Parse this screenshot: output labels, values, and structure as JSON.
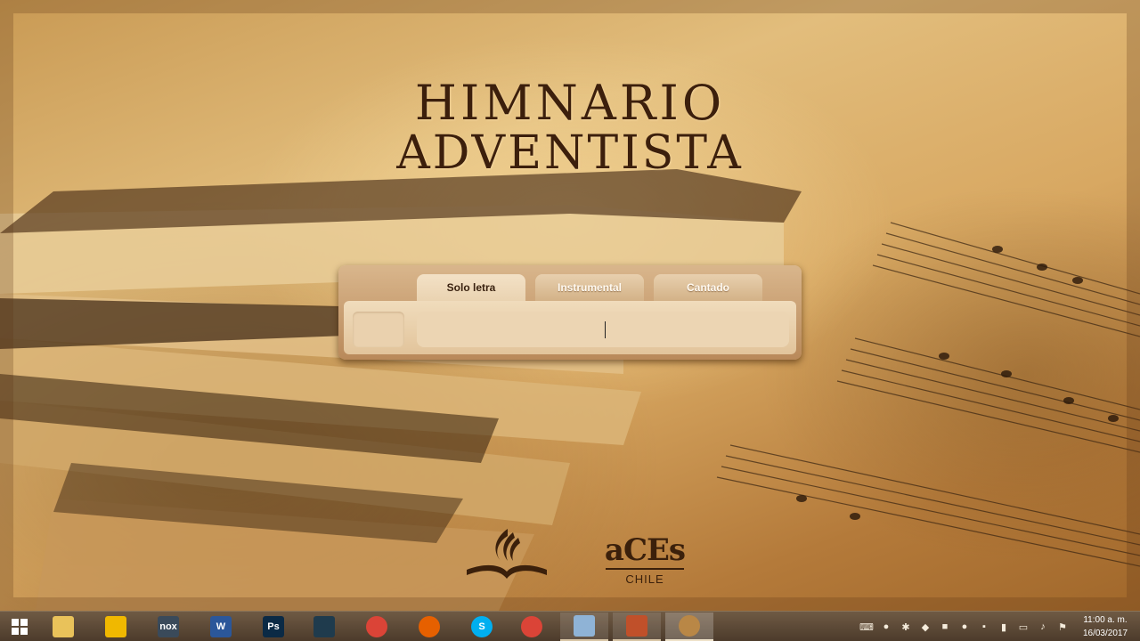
{
  "app": {
    "title_line1": "HIMNARIO",
    "title_line2": "ADVENTISTA"
  },
  "tabs": [
    {
      "label": "Solo letra",
      "active": true
    },
    {
      "label": "Instrumental",
      "active": false
    },
    {
      "label": "Cantado",
      "active": false
    }
  ],
  "search": {
    "value": "",
    "placeholder": ""
  },
  "logos": {
    "aces_word": "aCEs",
    "aces_country": "CHILE"
  },
  "taskbar": {
    "apps": [
      {
        "name": "file-explorer-icon",
        "color": "#e9c25a"
      },
      {
        "name": "headphones-icon",
        "color": "#f0b800"
      },
      {
        "name": "nox-icon",
        "color": "#3a4a5a",
        "glyph": "nox"
      },
      {
        "name": "word-icon",
        "color": "#2b579a",
        "glyph": "W"
      },
      {
        "name": "photoshop-icon",
        "color": "#0b2a45",
        "glyph": "Ps"
      },
      {
        "name": "app-arrow-icon",
        "color": "#1f3b4d"
      },
      {
        "name": "chrome-icon",
        "color": "#db4437"
      },
      {
        "name": "firefox-icon",
        "color": "#e66000"
      },
      {
        "name": "skype-icon",
        "color": "#00aff0",
        "glyph": "S"
      },
      {
        "name": "chrome-icon-2",
        "color": "#db4437"
      },
      {
        "name": "notes-icon",
        "color": "#8fb3d6"
      },
      {
        "name": "glove-icon",
        "color": "#c0502a"
      },
      {
        "name": "himnario-icon",
        "color": "#b98746"
      }
    ],
    "clock_time": "11:00 a. m.",
    "clock_date": "16/03/2017"
  },
  "colors": {
    "title": "#3c1f0c",
    "panel": "#c9a070",
    "taskbar": "#5c4835"
  }
}
